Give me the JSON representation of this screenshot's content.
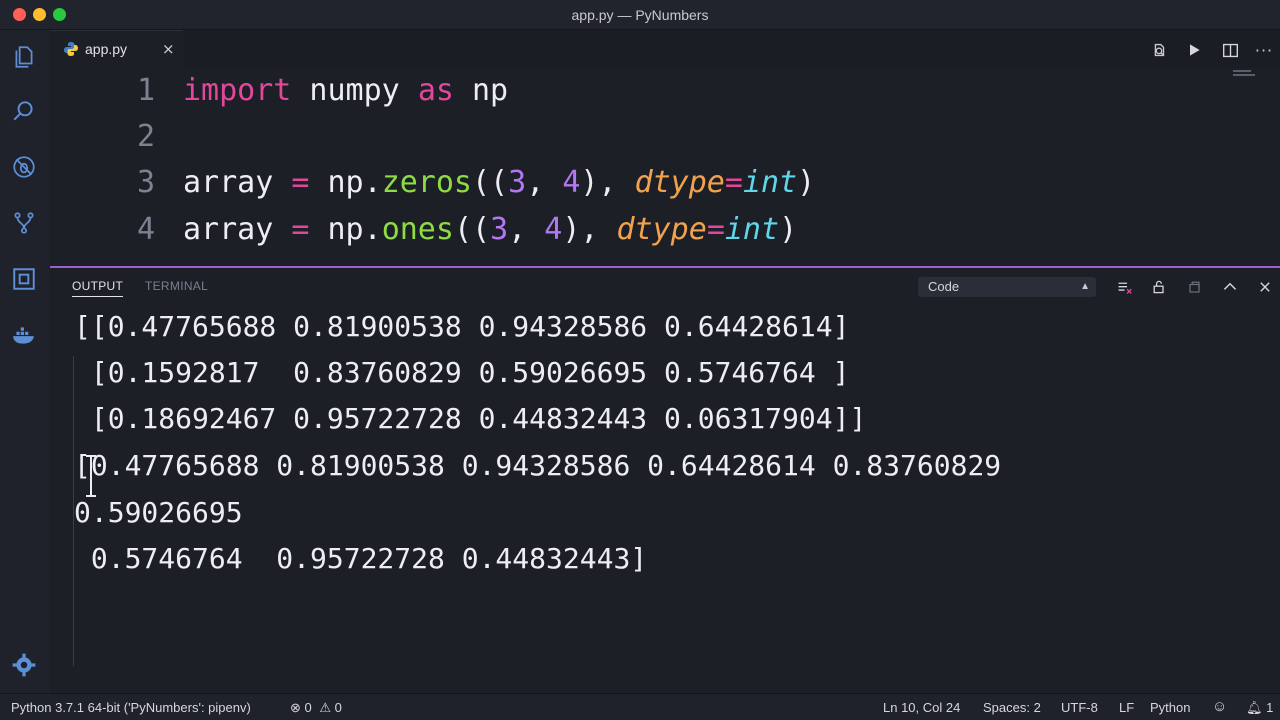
{
  "window": {
    "title": "app.py — PyNumbers",
    "traffic_lights": [
      "#ff5f57",
      "#febc2e",
      "#28c840"
    ]
  },
  "activity_bar": {
    "items": [
      "files-icon",
      "search-icon",
      "debug-icon",
      "source-control-icon",
      "extensions-icon",
      "docker-icon"
    ],
    "bottom": "gear-icon"
  },
  "tab": {
    "label": "app.py",
    "icon": "python-icon",
    "close": "×"
  },
  "editor_actions": [
    "open-changes-icon",
    "run-icon",
    "split-editor-icon",
    "more-icon"
  ],
  "editor": {
    "lines": [
      {
        "number": "1"
      },
      {
        "number": "2"
      },
      {
        "number": "3"
      },
      {
        "number": "4"
      }
    ],
    "line1": {
      "kw1": "import",
      "mod": " numpy ",
      "kw2": "as",
      "alias": " np"
    },
    "line3": {
      "var": "array ",
      "eq": "=",
      "obj": " np.",
      "fn": "zeros",
      "open": "((",
      "n1": "3",
      "comma": ", ",
      "n2": "4",
      "close": "), ",
      "param": "dtype",
      "peq": "=",
      "type": "int",
      "end": ")"
    },
    "line4": {
      "var": "array ",
      "eq": "=",
      "obj": " np.",
      "fn": "ones",
      "open": "((",
      "n1": "3",
      "comma": ", ",
      "n2": "4",
      "close": "), ",
      "param": "dtype",
      "peq": "=",
      "type": "int",
      "end": ")"
    }
  },
  "panel": {
    "tabs": [
      "OUTPUT",
      "TERMINAL"
    ],
    "active_tab": "OUTPUT",
    "channel": "Code",
    "actions": [
      "clear-output-icon",
      "lock-scroll-icon",
      "open-log-icon",
      "maximize-panel-icon",
      "close-panel-icon"
    ],
    "output_lines": [
      "[[0.47765688 0.81900538 0.94328586 0.64428614]",
      " [0.1592817  0.83760829 0.59026695 0.5746764 ]",
      " [0.18692467 0.95722728 0.44832443 0.06317904]]",
      "[0.47765688 0.81900538 0.94328586 0.64428614 0.83760829",
      "0.59026695",
      " 0.5746764  0.95722728 0.44832443]"
    ]
  },
  "status_bar": {
    "interpreter": "Python 3.7.1 64-bit ('PyNumbers': pipenv)",
    "errors": "0",
    "warnings": "0",
    "position": "Ln 10, Col 24",
    "spaces": "Spaces: 2",
    "encoding": "UTF-8",
    "eol": "LF",
    "language": "Python",
    "notifications": "1"
  },
  "colors": {
    "background": "#1d1f27",
    "keyword": "#e2479b",
    "function": "#8ddc43",
    "number": "#b277f2",
    "parameter": "#f0a34c",
    "type": "#5fd6ea",
    "panel_border": "#9c5fd1"
  }
}
